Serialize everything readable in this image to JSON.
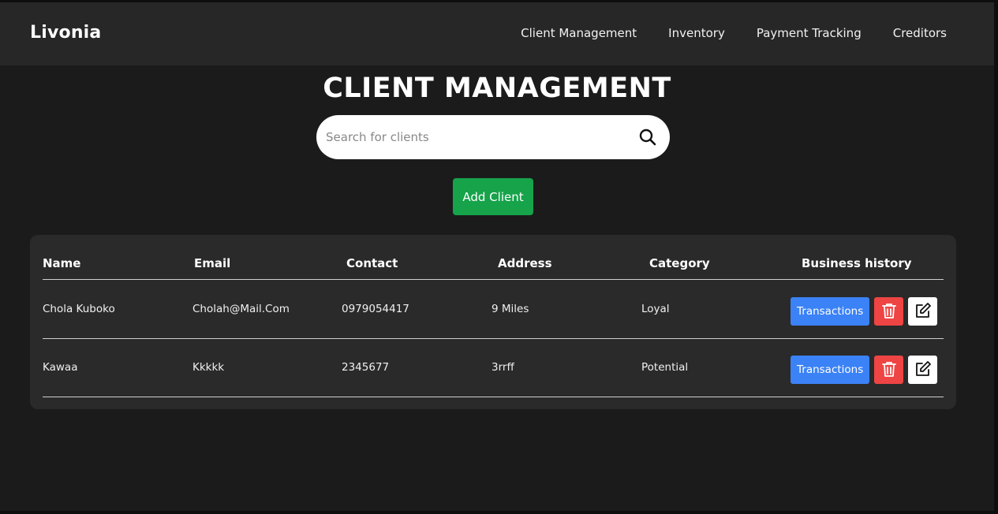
{
  "navbar": {
    "brand": "Livonia",
    "links": [
      {
        "label": "Client Management"
      },
      {
        "label": "Inventory"
      },
      {
        "label": "Payment Tracking"
      },
      {
        "label": "Creditors"
      }
    ]
  },
  "page": {
    "title": "CLIENT MANAGEMENT"
  },
  "search": {
    "placeholder": "Search for clients",
    "value": "",
    "icon": "search-icon"
  },
  "add_button": {
    "label": "Add Client",
    "color": "#16a34a"
  },
  "table": {
    "headers": [
      "Name",
      "Email",
      "Contact",
      "Address",
      "Category",
      "Business history"
    ],
    "rows": [
      {
        "name": "Chola Kuboko",
        "email": "Cholah@Mail.Com",
        "contact": "0979054417",
        "address": "9 Miles",
        "category": "Loyal"
      },
      {
        "name": "Kawaa",
        "email": "Kkkkk",
        "contact": "2345677",
        "address": "3rrff",
        "category": "Potential"
      }
    ],
    "actions": {
      "transactions_label": "Transactions",
      "delete_icon": "trash-icon",
      "edit_icon": "edit-icon",
      "transactions_color": "#3b82f6",
      "delete_color": "#ef4444"
    }
  }
}
